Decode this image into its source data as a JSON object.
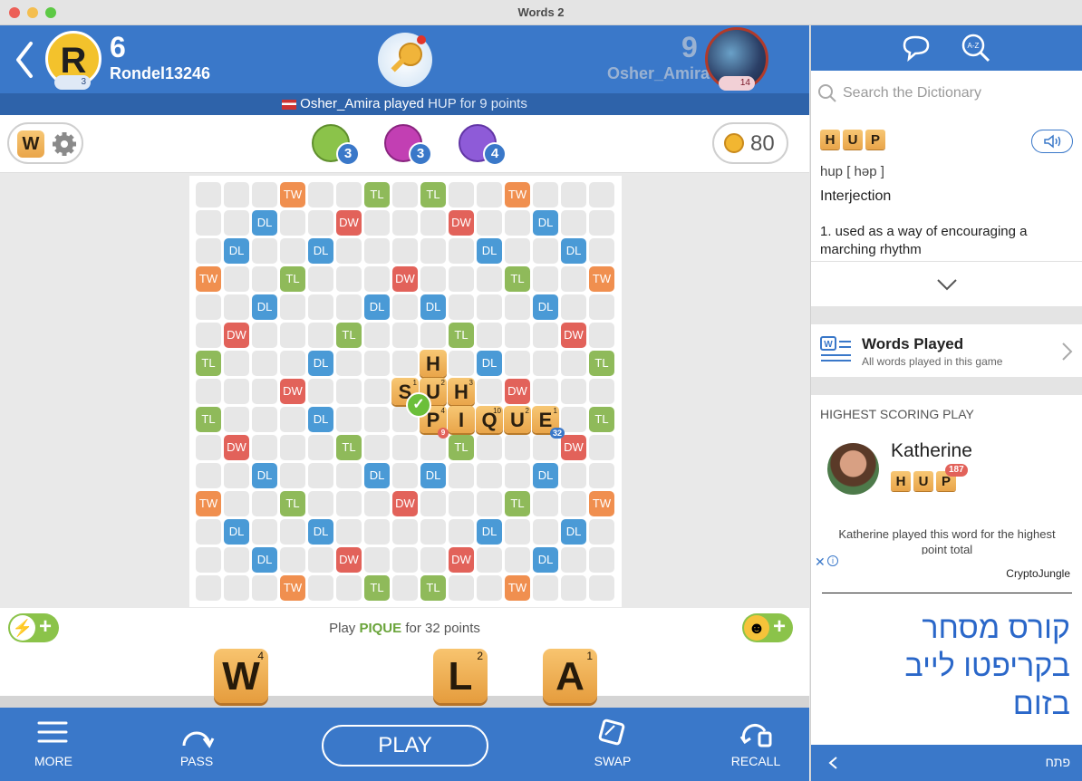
{
  "window": {
    "title": "Words 2"
  },
  "header": {
    "player": {
      "initial": "R",
      "score": "6",
      "name": "Rondel13246",
      "level": "3"
    },
    "opponent": {
      "score": "9",
      "name": "Osher_Amira",
      "level": "14"
    },
    "last_move": {
      "player": "Osher_Amira",
      "action": "played",
      "word_text": "HUP for 9 points"
    }
  },
  "toolbar": {
    "w_label": "W",
    "powerups": [
      {
        "count": "3",
        "color": "#8bc34a"
      },
      {
        "count": "3",
        "color": "#c23fb3"
      },
      {
        "count": "4",
        "color": "#8e5bd8"
      }
    ],
    "coins": "80"
  },
  "board": {
    "premium_colors": {
      "TW": "#f08f4f",
      "DW": "#e2625a",
      "TL": "#8fba5a",
      "DL": "#4a9ad6"
    },
    "premiums": [
      {
        "r": 0,
        "c": 3,
        "t": "TW"
      },
      {
        "r": 0,
        "c": 6,
        "t": "TL"
      },
      {
        "r": 0,
        "c": 8,
        "t": "TL"
      },
      {
        "r": 0,
        "c": 11,
        "t": "TW"
      },
      {
        "r": 1,
        "c": 2,
        "t": "DL"
      },
      {
        "r": 1,
        "c": 5,
        "t": "DW"
      },
      {
        "r": 1,
        "c": 9,
        "t": "DW"
      },
      {
        "r": 1,
        "c": 12,
        "t": "DL"
      },
      {
        "r": 2,
        "c": 1,
        "t": "DL"
      },
      {
        "r": 2,
        "c": 4,
        "t": "DL"
      },
      {
        "r": 2,
        "c": 10,
        "t": "DL"
      },
      {
        "r": 2,
        "c": 13,
        "t": "DL"
      },
      {
        "r": 3,
        "c": 0,
        "t": "TW"
      },
      {
        "r": 3,
        "c": 3,
        "t": "TL"
      },
      {
        "r": 3,
        "c": 7,
        "t": "DW"
      },
      {
        "r": 3,
        "c": 11,
        "t": "TL"
      },
      {
        "r": 3,
        "c": 14,
        "t": "TW"
      },
      {
        "r": 4,
        "c": 2,
        "t": "DL"
      },
      {
        "r": 4,
        "c": 6,
        "t": "DL"
      },
      {
        "r": 4,
        "c": 8,
        "t": "DL"
      },
      {
        "r": 4,
        "c": 12,
        "t": "DL"
      },
      {
        "r": 5,
        "c": 1,
        "t": "DW"
      },
      {
        "r": 5,
        "c": 5,
        "t": "TL"
      },
      {
        "r": 5,
        "c": 9,
        "t": "TL"
      },
      {
        "r": 5,
        "c": 13,
        "t": "DW"
      },
      {
        "r": 6,
        "c": 0,
        "t": "TL"
      },
      {
        "r": 6,
        "c": 4,
        "t": "DL"
      },
      {
        "r": 6,
        "c": 10,
        "t": "DL"
      },
      {
        "r": 6,
        "c": 14,
        "t": "TL"
      },
      {
        "r": 7,
        "c": 3,
        "t": "DW"
      },
      {
        "r": 7,
        "c": 11,
        "t": "DW"
      },
      {
        "r": 8,
        "c": 0,
        "t": "TL"
      },
      {
        "r": 8,
        "c": 4,
        "t": "DL"
      },
      {
        "r": 8,
        "c": 14,
        "t": "TL"
      },
      {
        "r": 9,
        "c": 1,
        "t": "DW"
      },
      {
        "r": 9,
        "c": 5,
        "t": "TL"
      },
      {
        "r": 9,
        "c": 9,
        "t": "TL"
      },
      {
        "r": 9,
        "c": 13,
        "t": "DW"
      },
      {
        "r": 10,
        "c": 2,
        "t": "DL"
      },
      {
        "r": 10,
        "c": 6,
        "t": "DL"
      },
      {
        "r": 10,
        "c": 8,
        "t": "DL"
      },
      {
        "r": 10,
        "c": 12,
        "t": "DL"
      },
      {
        "r": 11,
        "c": 0,
        "t": "TW"
      },
      {
        "r": 11,
        "c": 3,
        "t": "TL"
      },
      {
        "r": 11,
        "c": 7,
        "t": "DW"
      },
      {
        "r": 11,
        "c": 11,
        "t": "TL"
      },
      {
        "r": 11,
        "c": 14,
        "t": "TW"
      },
      {
        "r": 12,
        "c": 1,
        "t": "DL"
      },
      {
        "r": 12,
        "c": 4,
        "t": "DL"
      },
      {
        "r": 12,
        "c": 10,
        "t": "DL"
      },
      {
        "r": 12,
        "c": 13,
        "t": "DL"
      },
      {
        "r": 13,
        "c": 2,
        "t": "DL"
      },
      {
        "r": 13,
        "c": 5,
        "t": "DW"
      },
      {
        "r": 13,
        "c": 9,
        "t": "DW"
      },
      {
        "r": 13,
        "c": 12,
        "t": "DL"
      },
      {
        "r": 14,
        "c": 3,
        "t": "TW"
      },
      {
        "r": 14,
        "c": 6,
        "t": "TL"
      },
      {
        "r": 14,
        "c": 8,
        "t": "TL"
      },
      {
        "r": 14,
        "c": 11,
        "t": "TW"
      }
    ],
    "tiles": [
      {
        "r": 6,
        "c": 8,
        "l": "H",
        "v": ""
      },
      {
        "r": 7,
        "c": 7,
        "l": "S",
        "v": "1"
      },
      {
        "r": 7,
        "c": 8,
        "l": "U",
        "v": "2"
      },
      {
        "r": 7,
        "c": 9,
        "l": "H",
        "v": "3"
      },
      {
        "r": 8,
        "c": 8,
        "l": "P",
        "v": "4"
      },
      {
        "r": 8,
        "c": 9,
        "l": "I",
        "v": ""
      },
      {
        "r": 8,
        "c": 10,
        "l": "Q",
        "v": "10"
      },
      {
        "r": 8,
        "c": 11,
        "l": "U",
        "v": "2"
      },
      {
        "r": 8,
        "c": 12,
        "l": "E",
        "v": "1"
      }
    ],
    "score_badge_main": "32",
    "score_badge_small": "9"
  },
  "lower": {
    "play_prefix": "Play",
    "play_word": "PIQUE",
    "play_suffix": "for 32 points"
  },
  "rack": [
    {
      "l": "W",
      "v": "4"
    },
    {
      "l": "L",
      "v": "2"
    },
    {
      "l": "A",
      "v": "1"
    }
  ],
  "bottom": {
    "more": "MORE",
    "pass": "PASS",
    "play": "PLAY",
    "swap": "SWAP",
    "recall": "RECALL"
  },
  "side": {
    "search_placeholder": "Search the Dictionary",
    "word_letters": [
      "H",
      "U",
      "P"
    ],
    "pronunciation": "hup [ həp ]",
    "part_of_speech": "Interjection",
    "definition": "1. used as a way of encouraging a marching rhythm",
    "words_played_title": "Words Played",
    "words_played_sub": "All words played in this game",
    "highest_title": "HIGHEST SCORING PLAY",
    "highest_player": "Katherine",
    "highest_letters": [
      "H",
      "U",
      "P"
    ],
    "highest_score": "187",
    "highest_note": "Katherine played this word for the highest point total"
  },
  "ad": {
    "brand": "CryptoJungle",
    "headline": [
      "קורס מסחר",
      "בקריפטו לייב",
      "בזום"
    ],
    "open_label": "פתח"
  }
}
